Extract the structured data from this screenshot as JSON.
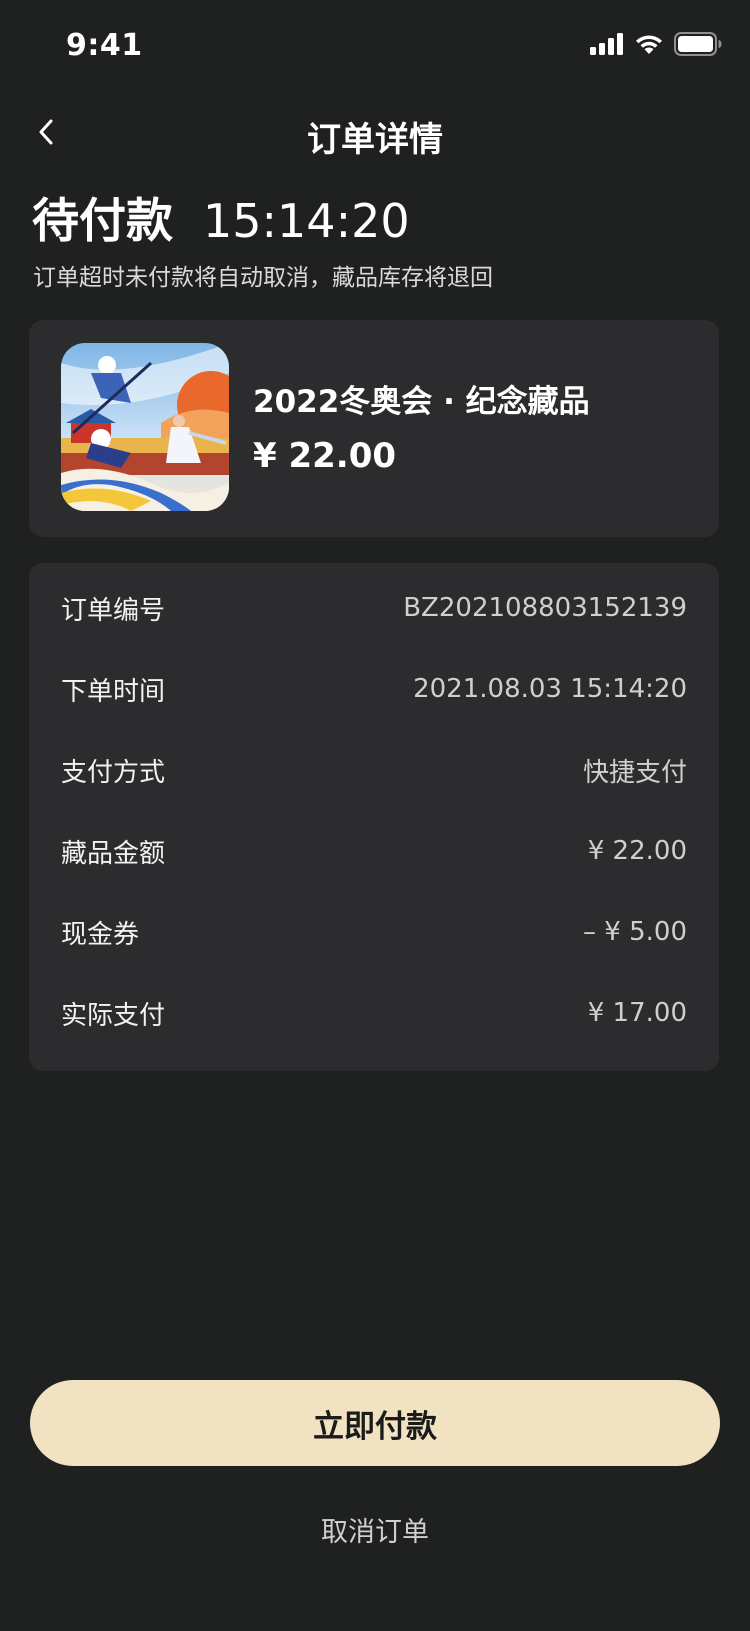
{
  "status_bar": {
    "time": "9:41",
    "icons": [
      "signal-icon",
      "wifi-icon",
      "battery-icon"
    ]
  },
  "nav": {
    "back_icon": "chevron-left-icon",
    "title": "订单详情"
  },
  "order_status": {
    "label": "待付款",
    "countdown": "15:14:20",
    "note": "订单超时未付款将自动取消，藏品库存将退回"
  },
  "product": {
    "name": "2022冬奥会 · 纪念藏品",
    "price": "¥ 22.00",
    "thumbnail_icon": "winter-olympics-artwork"
  },
  "details": [
    {
      "label": "订单编号",
      "value": "BZ202108803152139"
    },
    {
      "label": "下单时间",
      "value": "2021.08.03 15:14:20"
    },
    {
      "label": "支付方式",
      "value": "快捷支付"
    },
    {
      "label": "藏品金额",
      "value": "¥ 22.00"
    },
    {
      "label": "现金券",
      "value": "– ¥ 5.00"
    },
    {
      "label": "实际支付",
      "value": "¥ 17.00"
    }
  ],
  "actions": {
    "pay_label": "立即付款",
    "cancel_label": "取消订单"
  },
  "colors": {
    "background": "#1f2020",
    "card": "#2c2c2e",
    "accent": "#f1e2c2"
  }
}
